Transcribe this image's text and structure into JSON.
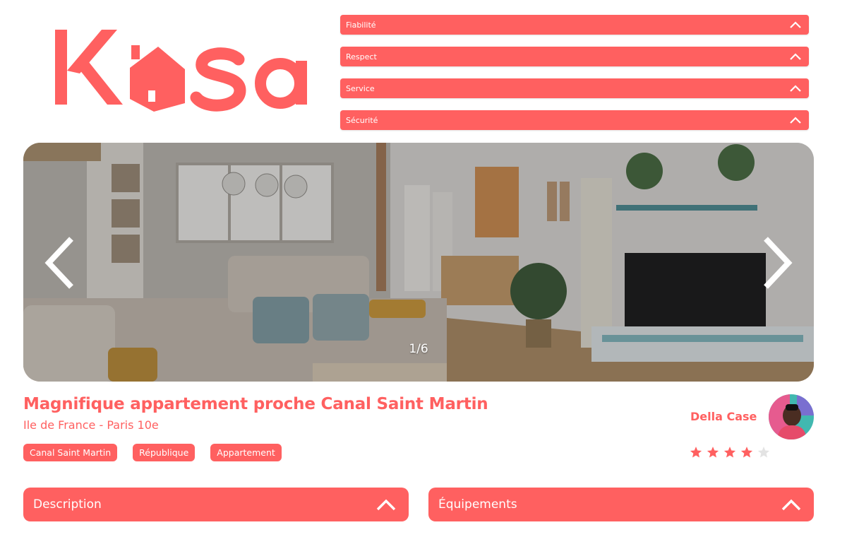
{
  "brand": {
    "logo_text": "Kasa",
    "accent": "#FF6060"
  },
  "top_collapses": [
    {
      "label": "Fiabilité",
      "icon": "chevron-up-icon"
    },
    {
      "label": "Respect",
      "icon": "chevron-up-icon"
    },
    {
      "label": "Service",
      "icon": "chevron-up-icon"
    },
    {
      "label": "Sécurité",
      "icon": "chevron-up-icon"
    }
  ],
  "gallery": {
    "counter": "1/6",
    "prev_icon": "chevron-left-icon",
    "next_icon": "chevron-right-icon"
  },
  "listing": {
    "title": "Magnifique appartement proche Canal Saint Martin",
    "location": "Ile de France - Paris 10e",
    "tags": [
      "Canal Saint Martin",
      "République",
      "Appartement"
    ]
  },
  "host": {
    "name": "Della Case",
    "rating": 4,
    "rating_max": 5
  },
  "bottom_collapses": {
    "description_label": "Description",
    "equipments_label": "Équipements"
  }
}
